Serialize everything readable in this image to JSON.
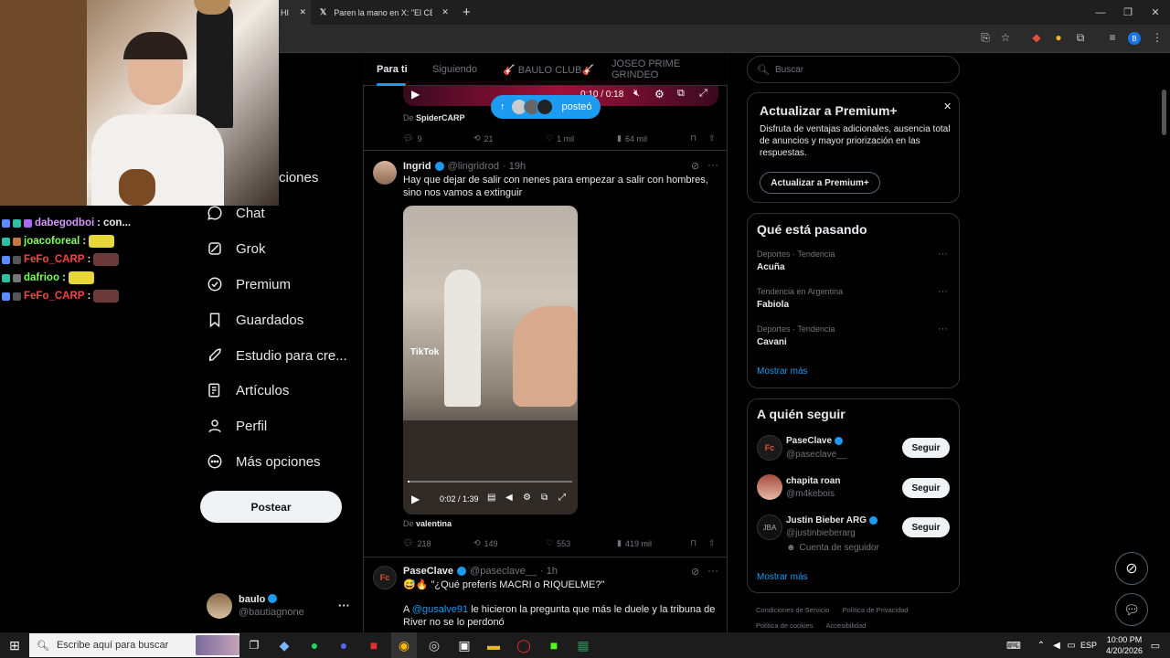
{
  "browser": {
    "tab1_title": "HI",
    "tab2_title": "Paren la mano en X: \"El CEO de",
    "new_tab": "+",
    "minimize": "—",
    "restore": "❐",
    "close": "✕"
  },
  "stream_chat": [
    {
      "user": "dabegodboi",
      "sep": ":",
      "msg": "con...",
      "color": "#d59aff"
    },
    {
      "user": "joacoforeal",
      "sep": ":",
      "msg": "",
      "color": "#7dff5a"
    },
    {
      "user": "FeFo_CARP",
      "sep": ":",
      "msg": "",
      "color": "#ff4242"
    },
    {
      "user": "dafrioo",
      "sep": ":",
      "msg": "",
      "color": "#7dff5a"
    },
    {
      "user": "FeFo_CARP",
      "sep": ":",
      "msg": "",
      "color": "#ff4242"
    }
  ],
  "nav": {
    "partial_item": "ciones",
    "items": [
      "Chat",
      "Grok",
      "Premium",
      "Guardados",
      "Estudio para cre...",
      "Artículos",
      "Perfil",
      "Más opciones"
    ],
    "post_button": "Postear",
    "account_name": "baulo",
    "account_handle": "@bautiagnone",
    "account_more": "···"
  },
  "feed": {
    "tabs": [
      "Para ti",
      "Siguiendo",
      "🎸 BAULO CLUB🎸",
      "JOSEO PRIME GRINDEO"
    ],
    "top_video": {
      "time": "0:10 / 0:18",
      "from_prefix": "De",
      "from_name": "SpiderCARP"
    },
    "new_posts_pill": "posteó",
    "top_actions": {
      "replies": "9",
      "reposts": "21",
      "likes": "1 mil",
      "views": "64 mil"
    },
    "post1": {
      "name": "Ingrid",
      "handle": "@lingridrod",
      "time": "· 19h",
      "text": "Hay que dejar de salir con nenes para empezar a salir con hombres, sino nos vamos a extinguir",
      "video_time": "0:02 / 1:39",
      "watermark": "TikTok",
      "from_prefix": "De",
      "from_name": "valentina",
      "replies": "218",
      "reposts": "149",
      "likes": "553",
      "views": "419 mil"
    },
    "post2": {
      "name": "PaseClave",
      "handle": "@paseclave__",
      "time": "· 1h",
      "line1": "😅🔥 \"¿Qué preferís MACRI o RIQUELME?\"",
      "mention_prefix": "A",
      "mention": "@gusalve91",
      "line2": "le hicieron la pregunta que más le duele y la tribuna de River no se lo perdonó"
    }
  },
  "right": {
    "search_placeholder": "Buscar",
    "premium": {
      "title": "Actualizar a Premium+",
      "text": "Disfruta de ventajas adicionales, ausencia total de anuncios y mayor priorización en las respuestas.",
      "button": "Actualizar a Premium+"
    },
    "trends": {
      "title": "Qué está pasando",
      "items": [
        {
          "context": "Deportes · Tendencia",
          "name": "Acuña"
        },
        {
          "context": "Tendencia en Argentina",
          "name": "Fabiola"
        },
        {
          "context": "Deportes · Tendencia",
          "name": "Cavani"
        }
      ],
      "more": "Mostrar más"
    },
    "follow": {
      "title": "A quién seguir",
      "items": [
        {
          "name": "PaseClave",
          "handle": "@paseclave__",
          "extra": "",
          "button": "Seguir"
        },
        {
          "name": "chapita roan",
          "handle": "@m4kebois",
          "extra": "",
          "button": "Seguir"
        },
        {
          "name": "Justin Bieber ARG",
          "handle": "@justinbieberarg",
          "extra": "Cuenta de seguidor",
          "button": "Seguir"
        }
      ],
      "more": "Mostrar más"
    },
    "footer": [
      "Condiciones de Servicio",
      "Política de Privacidad",
      "Política de cookies",
      "Accesibilidad"
    ]
  },
  "taskbar": {
    "search_placeholder": "Escribe aquí para buscar",
    "lang": "ESP",
    "time": "10:00 PM",
    "date": "4/20/2026"
  },
  "colors": {
    "accent": "#1d9bf0",
    "bg": "#000000",
    "text": "#e7e9ea",
    "muted": "#71767b"
  }
}
